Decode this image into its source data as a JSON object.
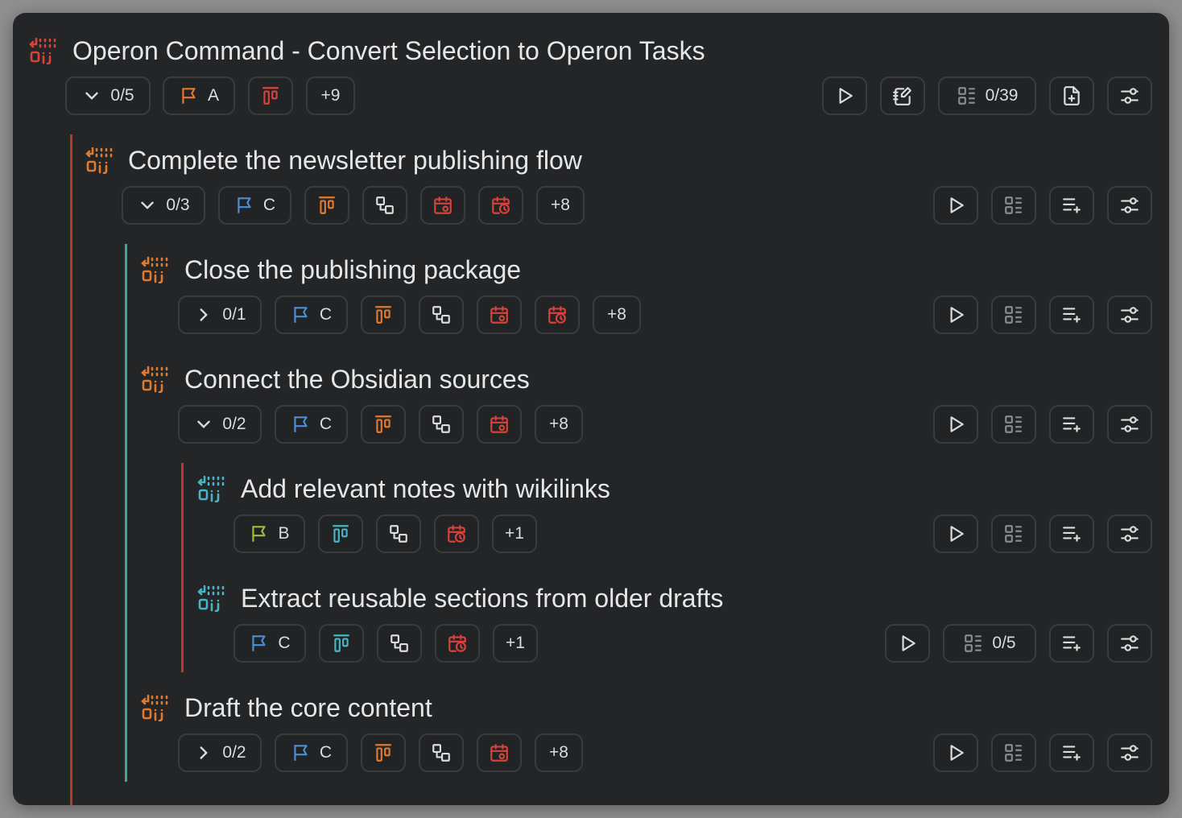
{
  "colors": {
    "red": "#d8423a",
    "orange": "#e07a2f",
    "blue": "#4a8fd6",
    "teal": "#48b5c7",
    "green": "#9ebe3c",
    "gray": "#8a8b8e",
    "red_line": "#b9372f",
    "teal_line": "#3fa893"
  },
  "root": {
    "title": "Operon Command - Convert Selection to Operon Tasks",
    "icon": "task-group-icon",
    "expand_label": "0/5",
    "priority_label": "A",
    "more_label": "+9",
    "checklist_label": "0/39"
  },
  "tasks": [
    {
      "title": "Complete the newsletter publishing flow",
      "expand_label": "0/3",
      "priority_label": "C",
      "more_label": "+8"
    },
    {
      "title": "Close the publishing package",
      "expand_label": "0/1",
      "priority_label": "C",
      "more_label": "+8"
    },
    {
      "title": "Connect the Obsidian sources",
      "expand_label": "0/2",
      "priority_label": "C",
      "more_label": "+8"
    },
    {
      "title": "Add relevant notes with wikilinks",
      "priority_label": "B",
      "more_label": "+1"
    },
    {
      "title": "Extract reusable sections from older drafts",
      "priority_label": "C",
      "more_label": "+1",
      "checklist_label": "0/5"
    },
    {
      "title": "Draft the core content",
      "expand_label": "0/2",
      "priority_label": "C",
      "more_label": "+8"
    }
  ]
}
